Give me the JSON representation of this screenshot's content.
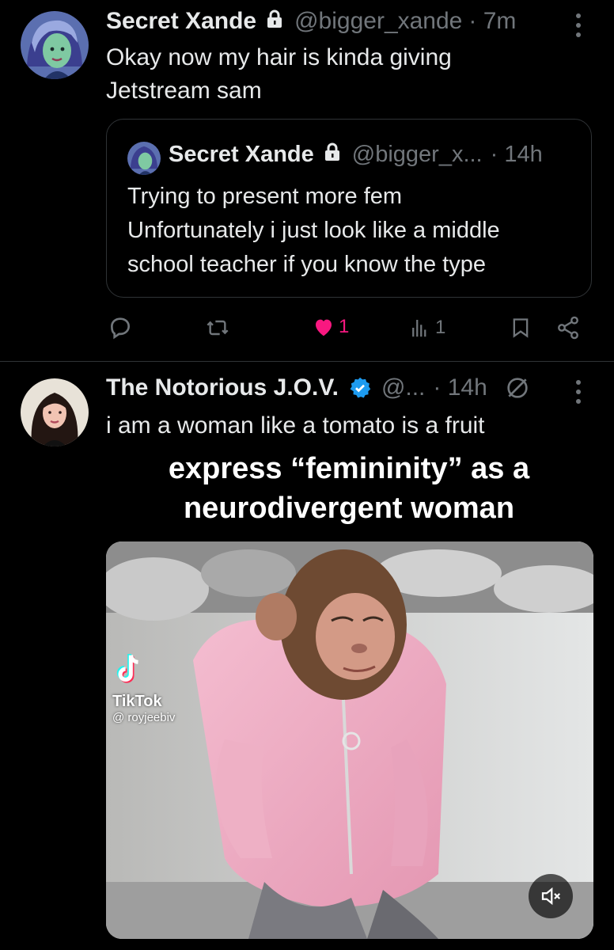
{
  "tweet1": {
    "display_name": "Secret Xande",
    "handle": "@bigger_xande",
    "time": "· 7m",
    "text_line1": "Okay now my hair is kinda giving",
    "text_line2": "Jetstream sam",
    "quote": {
      "display_name": "Secret Xande",
      "handle": "@bigger_x...",
      "time": "· 14h",
      "line1": "Trying to present more fem",
      "line2": "Unfortunately i just look like a middle",
      "line3": "school teacher if you know the type"
    },
    "actions": {
      "likes": "1",
      "views": "1"
    }
  },
  "tweet2": {
    "display_name": "The Notorious J.O.V.",
    "handle": "@...",
    "time": "· 14h",
    "text": "i am a woman like a tomato is a fruit",
    "caption_line1": "express “femininity” as a",
    "caption_line2": "neurodivergent woman",
    "watermark_name": "TikTok",
    "watermark_handle": "@ royjeebiv"
  },
  "colors": {
    "background": "#000000",
    "text": "#e7e9ea",
    "muted": "#71767b",
    "like": "#f91880",
    "verified": "#1d9bf0",
    "border": "#2f3336"
  },
  "icons": [
    "lock-icon",
    "more-icon",
    "reply-icon",
    "retweet-icon",
    "heart-icon",
    "views-icon",
    "bookmark-icon",
    "share-icon",
    "verified-icon",
    "grok-icon",
    "mute-icon",
    "tiktok-icon"
  ]
}
